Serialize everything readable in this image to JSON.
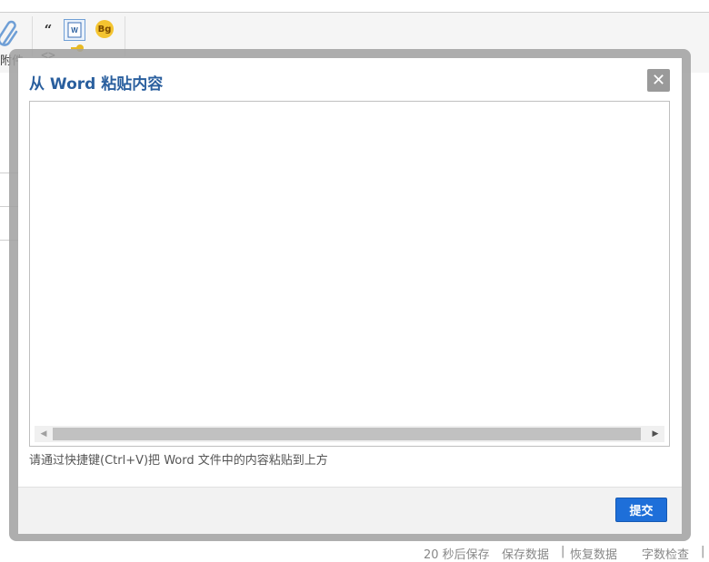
{
  "editor": {
    "attach_label": "附件",
    "toolbar": {
      "quote_glyph": "“",
      "word_icon_letter": "W",
      "bg_icon_label": "Bg",
      "code_glyph": "<>"
    }
  },
  "dialog": {
    "title": "从 Word 粘贴内容",
    "close_glyph": "✕",
    "paste_area_value": "",
    "hint": "请通过快捷键(Ctrl+V)把 Word 文件中的内容粘贴到上方",
    "submit_label": "提交"
  },
  "statusbar": {
    "autosave": "20 秒后保存",
    "save_data": "保存数据",
    "sep1": "|",
    "restore_data": "恢复数据",
    "word_count": "字数检查",
    "sep2": "|"
  },
  "colors": {
    "title": "#2a5f9e",
    "submit_button": "#1e6fd9",
    "close_button": "#9a9a9a"
  }
}
